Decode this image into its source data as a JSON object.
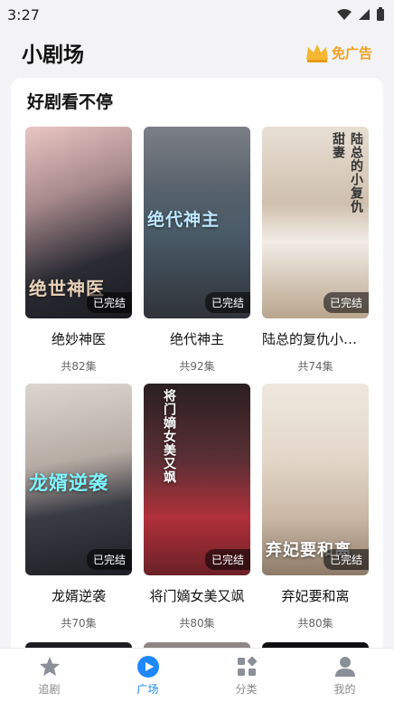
{
  "status": {
    "time": "3:27"
  },
  "header": {
    "title": "小剧场",
    "no_ads": "免广告"
  },
  "section": {
    "title": "好剧看不停"
  },
  "colors": {
    "accent": "#1e88ff",
    "ad_gold": "#f0a020"
  },
  "dramas": [
    {
      "title": "绝妙神医",
      "episodes": "共82集",
      "badge": "已完结",
      "poster_text": "绝世神医"
    },
    {
      "title": "绝代神主",
      "episodes": "共92集",
      "badge": "已完结",
      "poster_text": "绝代神主"
    },
    {
      "title": "陆总的复仇小甜...",
      "episodes": "共74集",
      "badge": "已完结",
      "poster_text": "陆总的小复仇甜妻"
    },
    {
      "title": "龙婿逆袭",
      "episodes": "共70集",
      "badge": "已完结",
      "poster_text": "龙婿逆袭"
    },
    {
      "title": "将门嫡女美又飒",
      "episodes": "共80集",
      "badge": "已完结",
      "poster_text": "将门嫡女美又飒"
    },
    {
      "title": "弃妃要和离",
      "episodes": "共80集",
      "badge": "已完结",
      "poster_text": "弃妃要和离"
    }
  ],
  "tabs": [
    {
      "label": "追剧",
      "icon": "star-icon"
    },
    {
      "label": "广场",
      "icon": "play-icon"
    },
    {
      "label": "分类",
      "icon": "category-icon"
    },
    {
      "label": "我的",
      "icon": "profile-icon"
    }
  ]
}
